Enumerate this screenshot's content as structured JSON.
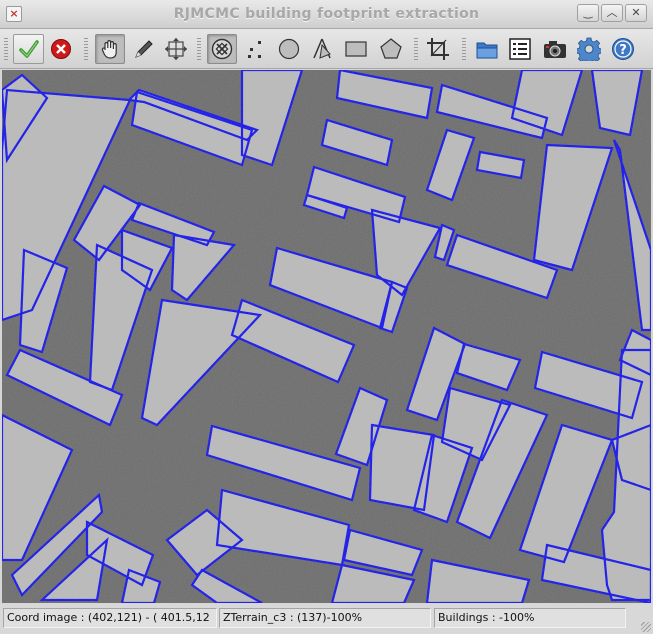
{
  "window": {
    "title": "RJMCMC building footprint extraction",
    "menu_glyph": "×",
    "buttons": [
      {
        "name": "minimize-button",
        "glyph": "‿"
      },
      {
        "name": "maximize-button",
        "glyph": "︿"
      },
      {
        "name": "close-button",
        "glyph": "✕"
      }
    ]
  },
  "toolbar": {
    "tools": [
      {
        "name": "validate-icon",
        "pressed": false
      },
      {
        "name": "cancel-icon",
        "pressed": false
      },
      {
        "name": "hand-pan-icon",
        "pressed": true
      },
      {
        "name": "pencil-icon",
        "pressed": false
      },
      {
        "name": "move-icon",
        "pressed": false
      },
      {
        "name": "rotated-rectangle-icon",
        "pressed": true
      },
      {
        "name": "points-icon",
        "pressed": false
      },
      {
        "name": "circle-icon",
        "pressed": false
      },
      {
        "name": "compass-icon",
        "pressed": false
      },
      {
        "name": "rectangle-icon",
        "pressed": false
      },
      {
        "name": "polygon-icon",
        "pressed": false
      },
      {
        "name": "crop-icon",
        "pressed": false
      },
      {
        "name": "open-folder-icon",
        "pressed": false
      },
      {
        "name": "layers-list-icon",
        "pressed": false
      },
      {
        "name": "camera-icon",
        "pressed": false
      },
      {
        "name": "settings-gear-icon",
        "pressed": false
      },
      {
        "name": "help-icon",
        "pressed": false
      }
    ]
  },
  "viewer": {
    "outline_color": "#1111ee",
    "image_tone": "#6a6a6a"
  },
  "status": {
    "coord": "Coord image : (402,121) - ( 401.5,12",
    "terrain": "ZTerrain_c3 : (137)-100%",
    "buildings": "Buildings : -100%"
  }
}
